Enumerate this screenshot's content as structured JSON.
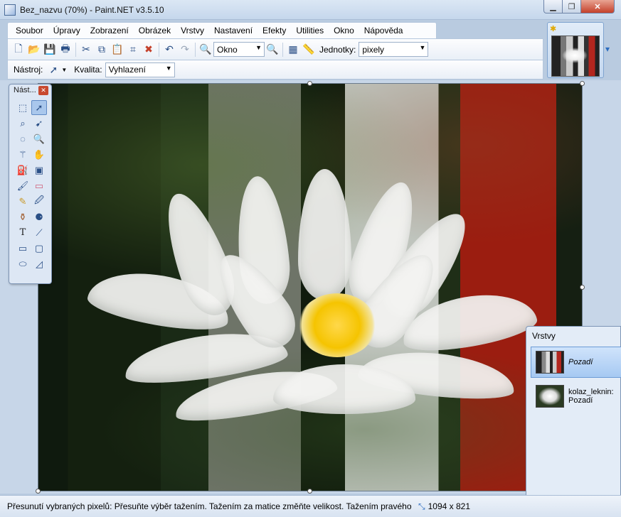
{
  "window": {
    "title": "Bez_nazvu (70%) - Paint.NET v3.5.10"
  },
  "menu": [
    "Soubor",
    "Úpravy",
    "Zobrazení",
    "Obrázek",
    "Vrstvy",
    "Nastavení",
    "Efekty",
    "Utilities",
    "Okno",
    "Nápověda"
  ],
  "toolbar": {
    "zoom_value": "Okno",
    "units_label": "Jednotky:",
    "units_value": "pixely",
    "tool_label": "Nástroj:",
    "quality_label": "Kvalita:",
    "quality_value": "Vyhlazení"
  },
  "tools_window": {
    "title": "Nást..."
  },
  "layers_window": {
    "title": "Vrstvy",
    "layers": [
      {
        "name": "Pozadí",
        "selected": true
      },
      {
        "name": "kolaz_leknin: Pozadí",
        "selected": false
      }
    ]
  },
  "status": {
    "text": "Přesunutí vybraných pixelů: Přesuňte výběr tažením. Tažením za matice změňte velikost. Tažením pravého tl",
    "size": "1094 x 821"
  },
  "colors": {
    "accent": "#2b6cc0",
    "close": "#c4402a"
  }
}
